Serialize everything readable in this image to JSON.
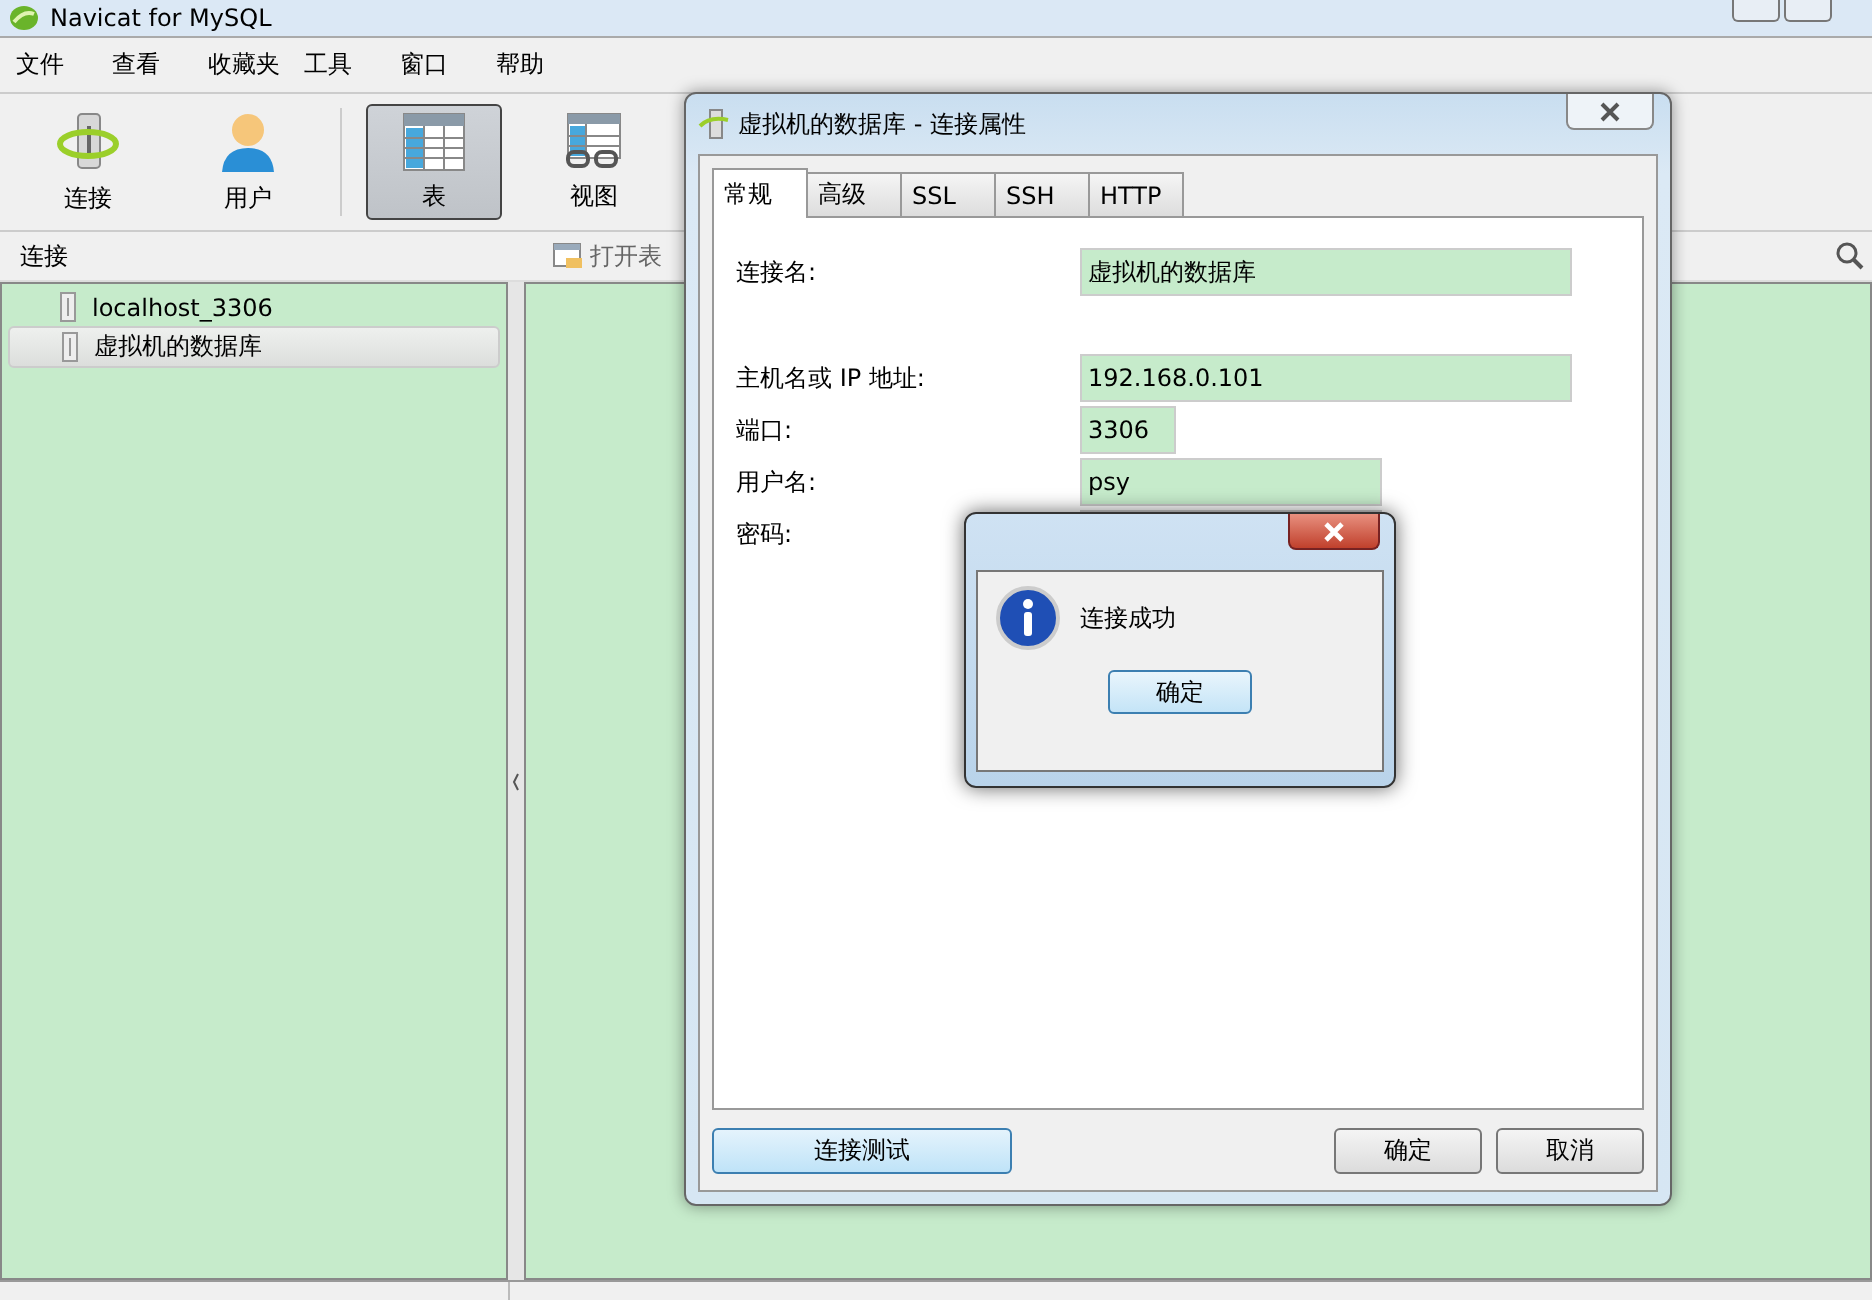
{
  "window": {
    "title": "Navicat for MySQL"
  },
  "menu": [
    {
      "label": "文件"
    },
    {
      "label": "查看"
    },
    {
      "label": "收藏夹"
    },
    {
      "label": "工具"
    },
    {
      "label": "窗口"
    },
    {
      "label": "帮助"
    }
  ],
  "toolbar": [
    {
      "label": "连接",
      "kind": "connection",
      "selected": false
    },
    {
      "label": "用户",
      "kind": "user",
      "selected": false
    },
    {
      "label": "表",
      "kind": "table",
      "selected": true
    },
    {
      "label": "视图",
      "kind": "view",
      "selected": false
    }
  ],
  "sidebar": {
    "title": "连接",
    "items": [
      {
        "label": "localhost_3306",
        "selected": false
      },
      {
        "label": "虚拟机的数据库",
        "selected": true
      }
    ]
  },
  "object_toolbar": [
    {
      "label": "打开表"
    }
  ],
  "dialog": {
    "title": "虚拟机的数据库 - 连接属性",
    "tabs": [
      {
        "label": "常规",
        "selected": true
      },
      {
        "label": "高级",
        "selected": false
      },
      {
        "label": "SSL",
        "selected": false
      },
      {
        "label": "SSH",
        "selected": false
      },
      {
        "label": "HTTP",
        "selected": false
      }
    ],
    "fields": [
      {
        "kind": "name",
        "label": "连接名:",
        "value": "虚拟机的数据库"
      },
      {
        "kind": "host",
        "label": "主机名或 IP 地址:",
        "value": "192.168.0.101"
      },
      {
        "kind": "port",
        "label": "端口:",
        "value": "3306"
      },
      {
        "kind": "user",
        "label": "用户名:",
        "value": "psy"
      },
      {
        "kind": "password",
        "label": "密码:"
      }
    ],
    "test_button": "连接测试",
    "ok_button": "确定",
    "cancel_button": "取消"
  },
  "message_box": {
    "text": "连接成功",
    "button": "确定"
  }
}
